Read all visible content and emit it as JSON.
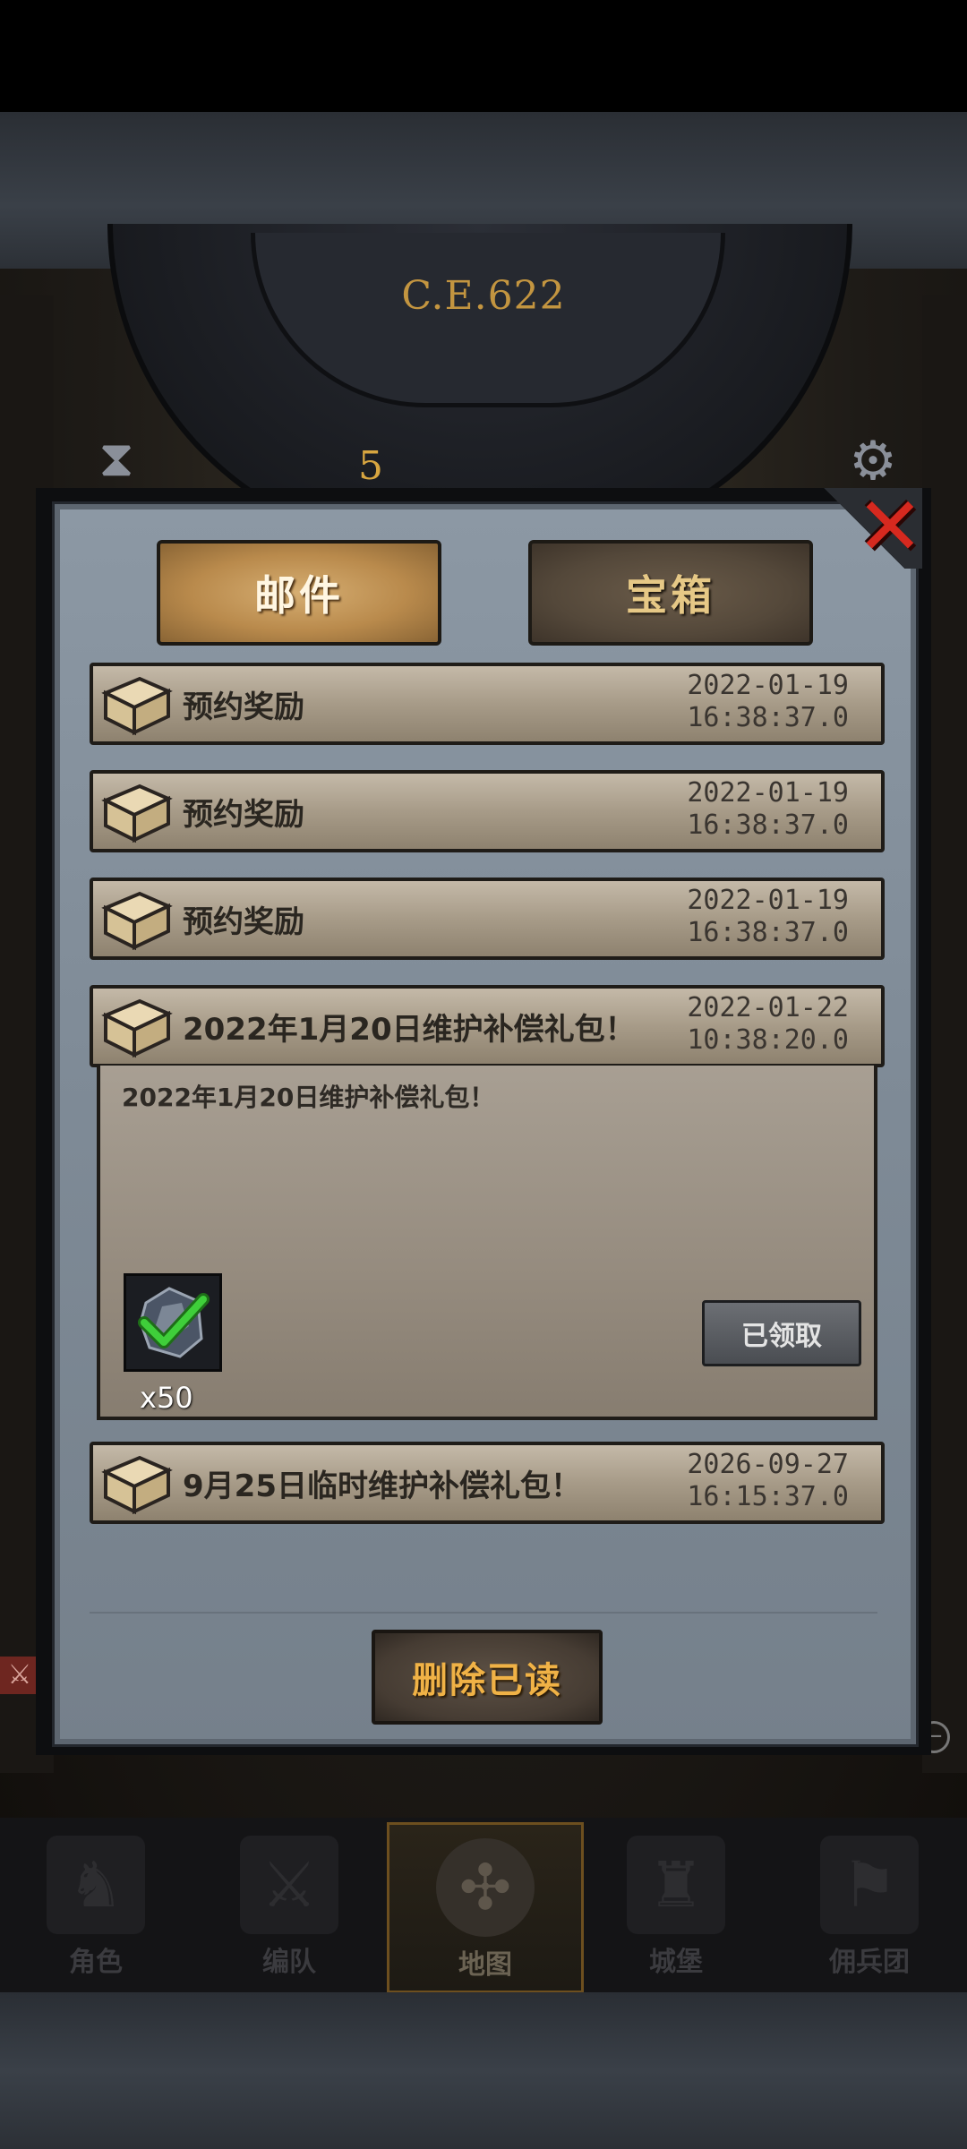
{
  "header": {
    "era_label": "C.E.622",
    "dial_number": "5"
  },
  "tabs": [
    {
      "label": "邮件",
      "active": true
    },
    {
      "label": "宝箱",
      "active": false
    }
  ],
  "mails": [
    {
      "title": "预约奖励",
      "date": "2022-01-19",
      "time": "16:38:37.0",
      "expanded": false
    },
    {
      "title": "预约奖励",
      "date": "2022-01-19",
      "time": "16:38:37.0",
      "expanded": false
    },
    {
      "title": "预约奖励",
      "date": "2022-01-19",
      "time": "16:38:37.0",
      "expanded": false
    },
    {
      "title": "2022年1月20日维护补偿礼包！",
      "date": "2022-01-22",
      "time": "10:38:20.0",
      "expanded": true,
      "body": "2022年1月20日维护补偿礼包！",
      "reward": {
        "icon": "crystal-ore-icon",
        "count": "x50",
        "claimed": true
      },
      "action_label": "已领取"
    },
    {
      "title": "9月25日临时维护补偿礼包！",
      "date": "2026-09-27",
      "time": "16:15:37.0",
      "expanded": false
    }
  ],
  "delete_read_label": "删除已读",
  "nav": [
    {
      "label": "角色",
      "icon": "knight-icon",
      "active": false
    },
    {
      "label": "编队",
      "icon": "formation-icon",
      "active": false
    },
    {
      "label": "地图",
      "icon": "map-compass-icon",
      "active": true
    },
    {
      "label": "城堡",
      "icon": "castle-icon",
      "active": false
    },
    {
      "label": "佣兵团",
      "icon": "mercenary-icon",
      "active": false
    }
  ],
  "colors": {
    "close": "#d6291f",
    "accent_gold": "#f0b246",
    "claimed_check": "#3fcf3a"
  }
}
